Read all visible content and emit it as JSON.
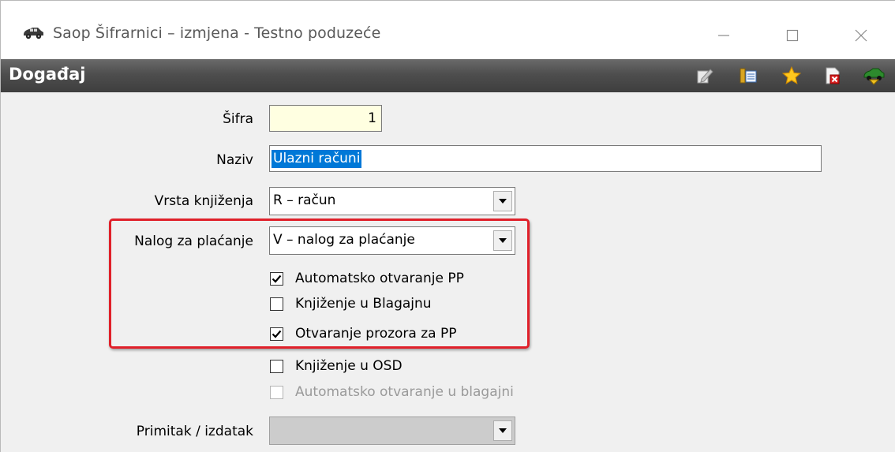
{
  "window": {
    "title": "Saop Šifrarnici – izmjena  - Testno poduzeće",
    "header_title": "Događaj"
  },
  "form": {
    "sifra": {
      "label": "Šifra",
      "value": "1"
    },
    "naziv": {
      "label": "Naziv",
      "value": "Ulazni računi"
    },
    "vrsta_knjizenja": {
      "label": "Vrsta knjiženja",
      "value": "R – račun"
    },
    "nalog_za_placanje": {
      "label": "Nalog za plaćanje",
      "value": "V – nalog za plaćanje"
    },
    "checkboxes": [
      {
        "label": "Automatsko otvaranje PP",
        "checked": true,
        "enabled": true
      },
      {
        "label": "Knjiženje u Blagajnu",
        "checked": false,
        "enabled": true
      },
      {
        "label": "Otvaranje prozora za PP",
        "checked": true,
        "enabled": true
      },
      {
        "label": "Knjiženje u OSD",
        "checked": false,
        "enabled": true
      },
      {
        "label": "Automatsko otvaranje u blagajni",
        "checked": false,
        "enabled": false
      }
    ],
    "primitak_izdatak": {
      "label": "Primitak / izdatak",
      "value": ""
    }
  },
  "colors": {
    "header_bg": "#4e4e4e",
    "highlight_border": "#e0202a",
    "sifra_bg": "#ffffe1",
    "selection": "#0078d7"
  },
  "icons": {
    "app": "car-icon",
    "toolbar": [
      "edit-icon",
      "list-icon",
      "star-icon",
      "delete-icon",
      "exit-icon"
    ]
  }
}
